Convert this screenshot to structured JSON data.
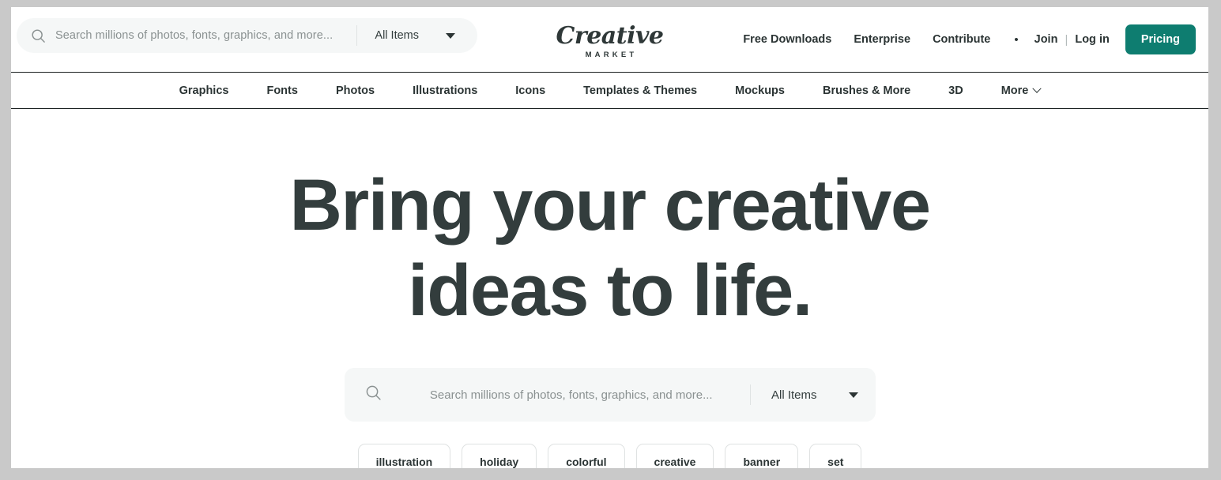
{
  "header": {
    "search": {
      "placeholder": "Search millions of photos, fonts, graphics, and more...",
      "value": "",
      "scope_label": "All Items",
      "search_icon": "search-icon",
      "caret_icon": "chevron-down-icon"
    },
    "logo": {
      "word": "Creative",
      "subword": "MARKET"
    },
    "right_nav": {
      "items": [
        {
          "label": "Free Downloads"
        },
        {
          "label": "Enterprise"
        },
        {
          "label": "Contribute"
        }
      ],
      "separator": "•",
      "join_label": "Join",
      "divider": "|",
      "login_label": "Log in",
      "pricing_label": "Pricing",
      "pricing_color": "#0e7d70"
    }
  },
  "category_nav": {
    "items": [
      {
        "label": "Graphics",
        "has_chevron": false
      },
      {
        "label": "Fonts",
        "has_chevron": false
      },
      {
        "label": "Photos",
        "has_chevron": false
      },
      {
        "label": "Illustrations",
        "has_chevron": false
      },
      {
        "label": "Icons",
        "has_chevron": false
      },
      {
        "label": "Templates & Themes",
        "has_chevron": false
      },
      {
        "label": "Mockups",
        "has_chevron": false
      },
      {
        "label": "Brushes & More",
        "has_chevron": false
      },
      {
        "label": "3D",
        "has_chevron": false
      },
      {
        "label": "More",
        "has_chevron": true
      }
    ]
  },
  "hero": {
    "headline_line1": "Bring your creative",
    "headline_line2": "ideas to life.",
    "headline_color": "#333d3d",
    "search": {
      "placeholder": "Search millions of photos, fonts, graphics, and more...",
      "value": "",
      "scope_label": "All Items",
      "search_icon": "search-icon",
      "caret_icon": "chevron-down-icon"
    },
    "tags": [
      {
        "label": "illustration"
      },
      {
        "label": "holiday"
      },
      {
        "label": "colorful"
      },
      {
        "label": "creative"
      },
      {
        "label": "banner"
      },
      {
        "label": "set"
      }
    ]
  }
}
